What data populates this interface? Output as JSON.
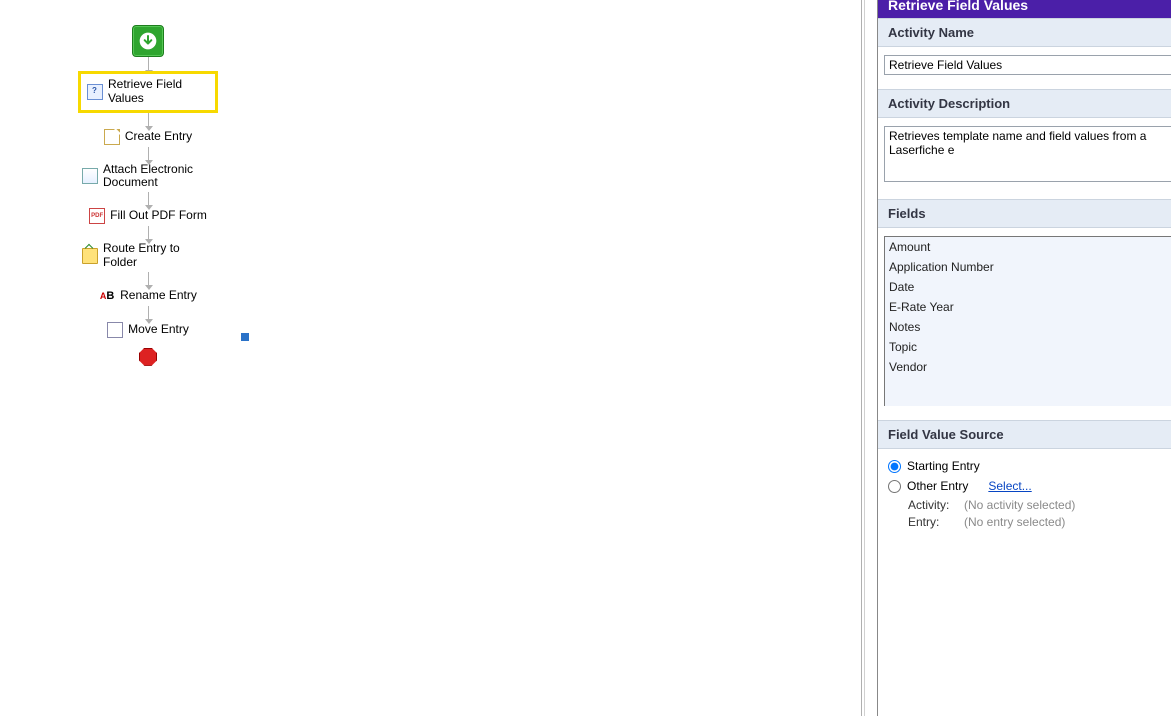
{
  "panel_title": "Retrieve Field Values",
  "sections": {
    "activity_name": {
      "header": "Activity Name",
      "value": "Retrieve Field Values"
    },
    "activity_desc": {
      "header": "Activity Description",
      "value": "Retrieves template name and field values from a Laserfiche e"
    },
    "fields": {
      "header": "Fields",
      "items": [
        "Amount",
        "Application Number",
        "Date",
        "E-Rate Year",
        "Notes",
        "Topic",
        "Vendor"
      ]
    },
    "source": {
      "header": "Field Value Source",
      "opt_starting": "Starting Entry",
      "opt_other": "Other Entry",
      "select_link": "Select...",
      "activity_label": "Activity:",
      "activity_value": "(No activity selected)",
      "entry_label": "Entry:",
      "entry_value": "(No entry selected)"
    }
  },
  "flow": {
    "retrieve": "Retrieve Field Values",
    "create": "Create Entry",
    "attach": "Attach Electronic Document",
    "pdf_icontext": "PDF",
    "pdf": "Fill Out PDF Form",
    "route": "Route Entry to Folder",
    "rename": "Rename Entry",
    "rename_icon_a": "A",
    "rename_icon_b": "B",
    "move": "Move Entry"
  }
}
